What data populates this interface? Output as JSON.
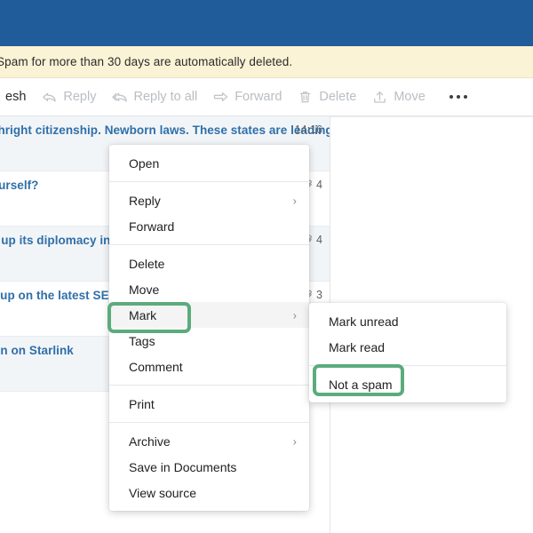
{
  "window": {
    "titlebar_color": "#1f5c99"
  },
  "notice": {
    "text": "Spam for more than 30 days are automatically deleted.",
    "background": "#fbf3d5"
  },
  "toolbar": {
    "items": [
      {
        "label": "esh",
        "icon": "refresh-icon",
        "disabled": false
      },
      {
        "label": "Reply",
        "icon": "reply-icon",
        "disabled": true
      },
      {
        "label": "Reply to all",
        "icon": "reply-all-icon",
        "disabled": true
      },
      {
        "label": "Forward",
        "icon": "forward-arrow-icon",
        "disabled": true
      },
      {
        "label": "Delete",
        "icon": "trash-icon",
        "disabled": true
      },
      {
        "label": "Move",
        "icon": "move-up-icon",
        "disabled": true
      }
    ],
    "more_label": "more-options"
  },
  "mail_list": {
    "rows": [
      {
        "subject": "Trump revokes birthright citizenship. Newborn laws. These states are leading the way",
        "time": "14:16",
        "attachments": ""
      },
      {
        "subject": "How do you see yourself?",
        "time": "",
        "attachments": "4"
      },
      {
        "subject": "Europe is stepping up its diplomacy into the",
        "time": "",
        "attachments": "4"
      },
      {
        "subject": "Your weekly round-up on the latest SEO",
        "time": "",
        "attachments": "3"
      },
      {
        "subject": "Elon Musk weighs in on Starlink",
        "time": "",
        "attachments": ""
      }
    ]
  },
  "context_menu": {
    "items": [
      {
        "label": "Open",
        "has_submenu": false,
        "highlighted": false
      },
      {
        "separator": true
      },
      {
        "label": "Reply",
        "has_submenu": true,
        "highlighted": false
      },
      {
        "label": "Forward",
        "has_submenu": false,
        "highlighted": false
      },
      {
        "separator": true
      },
      {
        "label": "Delete",
        "has_submenu": false,
        "highlighted": false
      },
      {
        "label": "Move",
        "has_submenu": false,
        "highlighted": false
      },
      {
        "label": "Mark",
        "has_submenu": true,
        "highlighted": true
      },
      {
        "label": "Tags",
        "has_submenu": false,
        "highlighted": false
      },
      {
        "label": "Comment",
        "has_submenu": false,
        "highlighted": false
      },
      {
        "separator": true
      },
      {
        "label": "Print",
        "has_submenu": false,
        "highlighted": false
      },
      {
        "separator": true
      },
      {
        "label": "Archive",
        "has_submenu": true,
        "highlighted": false
      },
      {
        "label": "Save in Documents",
        "has_submenu": false,
        "highlighted": false
      },
      {
        "label": "View source",
        "has_submenu": false,
        "highlighted": false
      }
    ],
    "submenu_arrow": "›"
  },
  "mark_submenu": {
    "items": [
      {
        "label": "Mark unread",
        "highlighted": false
      },
      {
        "label": "Mark read",
        "highlighted": false
      },
      {
        "separator": true
      },
      {
        "label": "Not a spam",
        "highlighted": true
      }
    ]
  },
  "annotations": {
    "color": "#5cab7d",
    "boxes": [
      {
        "target": "Mark"
      },
      {
        "target": "Not a spam"
      }
    ]
  }
}
